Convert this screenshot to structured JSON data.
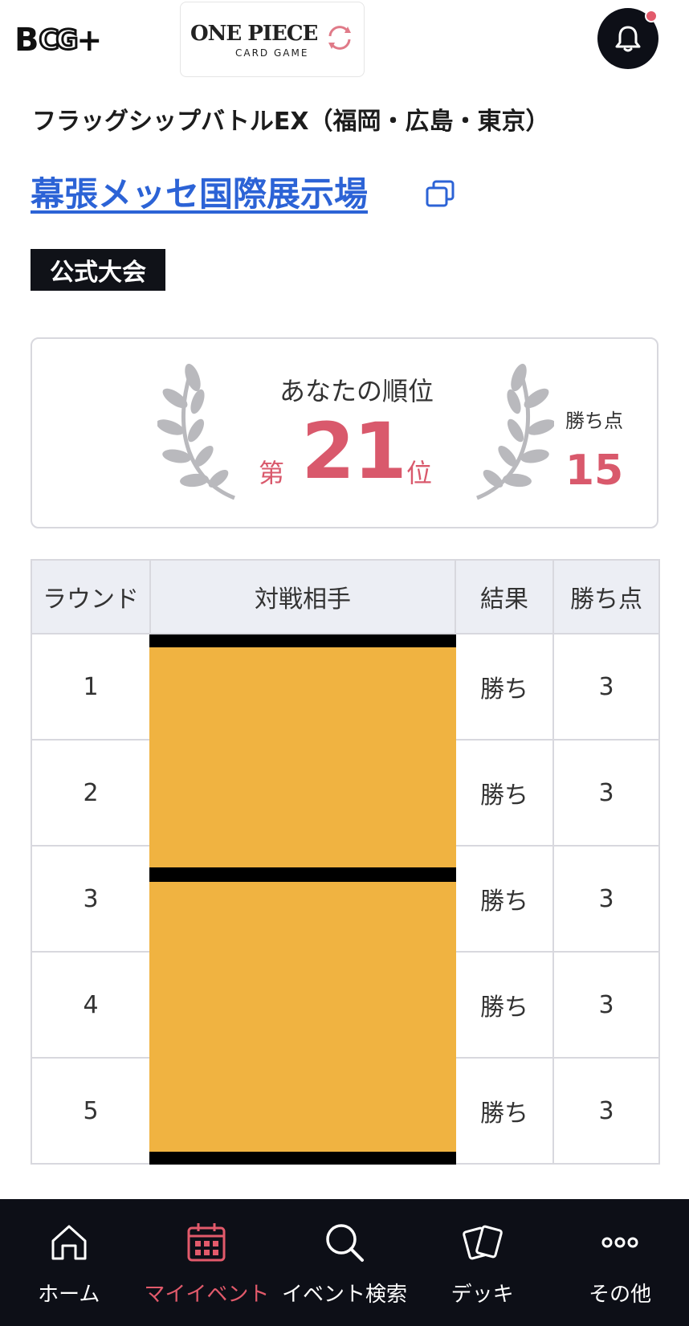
{
  "header": {
    "app_logo": "BCG+",
    "game_logo_title": "ONE PIECE",
    "game_logo_sub": "CARD GAME",
    "notification_dot": true
  },
  "event": {
    "name": "フラッグシップバトルEX（福岡・広島・東京）",
    "venue": "幕張メッセ国際展示場",
    "badge": "公式大会"
  },
  "ranking": {
    "label": "あなたの順位",
    "prefix": "第",
    "rank": "21",
    "suffix": "位",
    "points_label": "勝ち点",
    "points": "15"
  },
  "results_table": {
    "headers": [
      "ラウンド",
      "対戦相手",
      "結果",
      "勝ち点"
    ],
    "rows": [
      {
        "round": "1",
        "opponent": "",
        "result": "勝ち",
        "points": "3"
      },
      {
        "round": "2",
        "opponent": "",
        "result": "勝ち",
        "points": "3"
      },
      {
        "round": "3",
        "opponent": "",
        "result": "勝ち",
        "points": "3"
      },
      {
        "round": "4",
        "opponent": "",
        "result": "勝ち",
        "points": "3"
      },
      {
        "round": "5",
        "opponent": "",
        "result": "勝ち",
        "points": "3"
      }
    ]
  },
  "bottom_nav": {
    "items": [
      {
        "label": "ホーム",
        "icon": "home-icon",
        "active": false
      },
      {
        "label": "マイイベント",
        "icon": "calendar-icon",
        "active": true
      },
      {
        "label": "イベント検索",
        "icon": "search-icon",
        "active": false
      },
      {
        "label": "デッキ",
        "icon": "cards-icon",
        "active": false
      },
      {
        "label": "その他",
        "icon": "more-icon",
        "active": false
      }
    ]
  },
  "colors": {
    "accent": "#d9596c",
    "link": "#2c63d6",
    "nav_bg": "#0d0f17",
    "redaction": "#f0b341"
  }
}
